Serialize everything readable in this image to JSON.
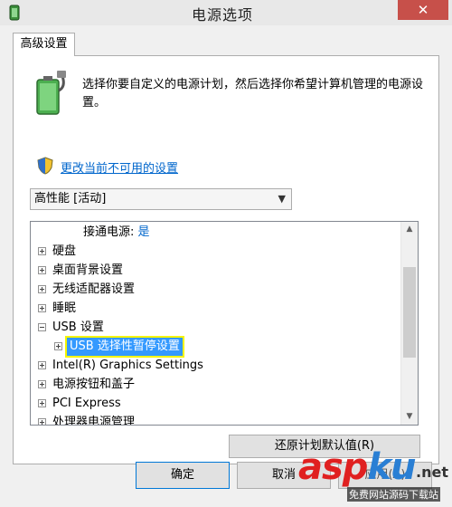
{
  "window": {
    "title": "电源选项",
    "close_glyph": "✕"
  },
  "dialog": {
    "tab_label": "高级设置",
    "intro_text": "选择你要自定义的电源计划，然后选择你希望计算机管理的电源设置。",
    "change_link": "更改当前不可用的设置",
    "plan_selected": "高性能 [活动]",
    "tree": {
      "ac_power_label": "接通电源:",
      "ac_power_value": "是",
      "items": [
        {
          "label": "硬盘",
          "expander": "plus"
        },
        {
          "label": "桌面背景设置",
          "expander": "plus"
        },
        {
          "label": "无线适配器设置",
          "expander": "plus"
        },
        {
          "label": "睡眠",
          "expander": "plus"
        },
        {
          "label": "USB 设置",
          "expander": "minus"
        },
        {
          "label": "USB 选择性暂停设置",
          "expander": "plus",
          "selected": true
        },
        {
          "label": "Intel(R) Graphics Settings",
          "expander": "plus"
        },
        {
          "label": "电源按钮和盖子",
          "expander": "plus"
        },
        {
          "label": "PCI Express",
          "expander": "plus"
        },
        {
          "label": "处理器电源管理",
          "expander": "plus"
        }
      ]
    },
    "restore_button": "还原计划默认值(R)",
    "ok_button": "确定",
    "cancel_button": "取消",
    "apply_button": "应用(A)"
  },
  "watermark": {
    "logo_part1": "asp",
    "logo_part2": "ku",
    "logo_suffix": ".net",
    "sub": "免费网站源码下载站"
  },
  "colors": {
    "selection": "#3399ff",
    "highlight_outline": "#f5f500",
    "link": "#0066cc",
    "close_button": "#c7504a"
  }
}
